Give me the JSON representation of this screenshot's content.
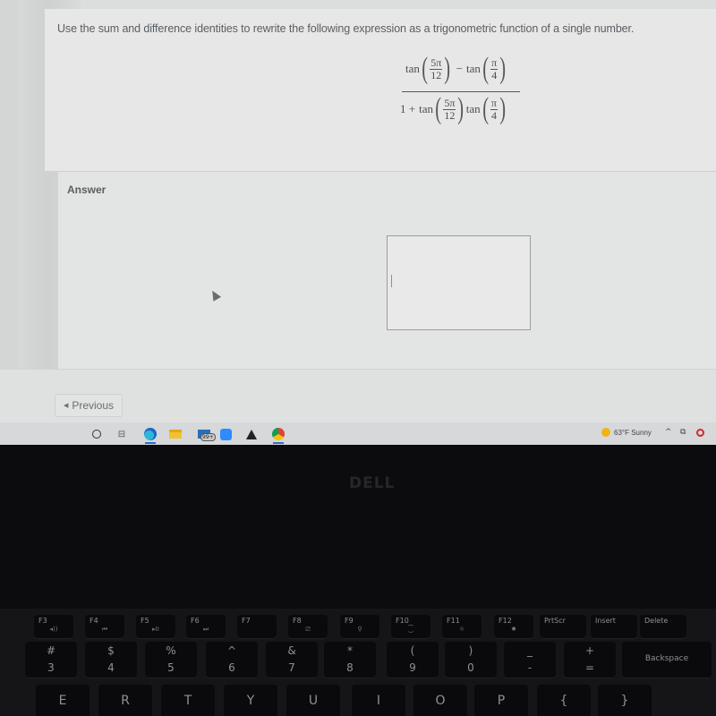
{
  "question": {
    "prompt": "Use the sum and difference identities to rewrite the following expression as a trigonometric function of a single number.",
    "expression": {
      "numerator": {
        "term1_fn": "tan",
        "term1_num": "5π",
        "term1_den": "12",
        "operator": "−",
        "term2_fn": "tan",
        "term2_num": "π",
        "term2_den": "4"
      },
      "denominator": {
        "lead": "1 +",
        "term1_fn": "tan",
        "term1_num": "5π",
        "term1_den": "12",
        "term2_fn": "tan",
        "term2_num": "π",
        "term2_den": "4"
      }
    }
  },
  "answer": {
    "label": "Answer",
    "value": ""
  },
  "navigation": {
    "previous_label": "Previous",
    "previous_icon": "triangle-left"
  },
  "taskbar": {
    "apps": [
      "search",
      "task-view",
      "edge",
      "file-explorer",
      "mail",
      "zoom",
      "inkscape",
      "chrome"
    ],
    "mail_badge": "99+",
    "weather": "63°F  Sunny",
    "tray_chevron": "^"
  },
  "laptop": {
    "brand": "DELL"
  },
  "keyboard": {
    "function_row": [
      {
        "label": "F3",
        "icon": "◂))"
      },
      {
        "label": "F4",
        "icon": "⏮"
      },
      {
        "label": "F5",
        "icon": "▸II"
      },
      {
        "label": "F6",
        "icon": "⏭"
      },
      {
        "label": "F7",
        "icon": ""
      },
      {
        "label": "F8",
        "icon": "⎚"
      },
      {
        "label": "F9",
        "icon": "⚲"
      },
      {
        "label": "F10",
        "icon": "⁐"
      },
      {
        "label": "F11",
        "icon": "☼"
      },
      {
        "label": "F12",
        "icon": "✹"
      },
      {
        "label": "PrtScr",
        "icon": ""
      },
      {
        "label": "Insert",
        "icon": ""
      },
      {
        "label": "Delete",
        "icon": ""
      }
    ],
    "number_row": [
      {
        "upper": "#",
        "lower": "3"
      },
      {
        "upper": "$",
        "lower": "4"
      },
      {
        "upper": "%",
        "lower": "5"
      },
      {
        "upper": "^",
        "lower": "6"
      },
      {
        "upper": "&",
        "lower": "7"
      },
      {
        "upper": "*",
        "lower": "8"
      },
      {
        "upper": "(",
        "lower": "9"
      },
      {
        "upper": ")",
        "lower": "0"
      },
      {
        "upper": "_",
        "lower": "-"
      },
      {
        "upper": "+",
        "lower": "="
      }
    ],
    "backspace": "Backspace",
    "letter_row": [
      "E",
      "R",
      "T",
      "Y",
      "U",
      "I",
      "O",
      "P",
      "{",
      "}"
    ]
  }
}
